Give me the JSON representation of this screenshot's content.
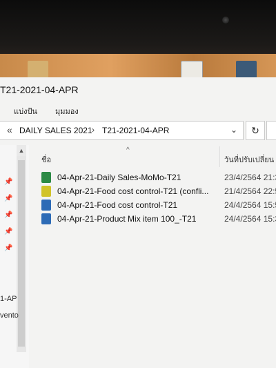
{
  "window": {
    "title": "T21-2021-04-APR"
  },
  "ribbon": {
    "share": "แบ่งปัน",
    "view": "มุมมอง"
  },
  "address": {
    "parent": "DAILY SALES 2021",
    "current": "T21-2021-04-APR"
  },
  "columns": {
    "name": "ชื่อ",
    "date_modified": "วันที่ปรับเปลี่ยน"
  },
  "nav": {
    "items": [
      "1-AP",
      "vento"
    ]
  },
  "files": [
    {
      "name": "04-Apr-21-Daily Sales-MoMo-T21",
      "date": "23/4/2564 21:3",
      "icon": "excel-green-icon"
    },
    {
      "name": "04-Apr-21-Food cost control-T21 (confli...",
      "date": "21/4/2564 22:5",
      "icon": "excel-yellow-icon"
    },
    {
      "name": "04-Apr-21-Food cost control-T21",
      "date": "24/4/2564 15:5",
      "icon": "excel-blue-icon"
    },
    {
      "name": "04-Apr-21-Product Mix item 100_-T21",
      "date": "24/4/2564 15:3",
      "icon": "excel-blue-icon"
    }
  ]
}
